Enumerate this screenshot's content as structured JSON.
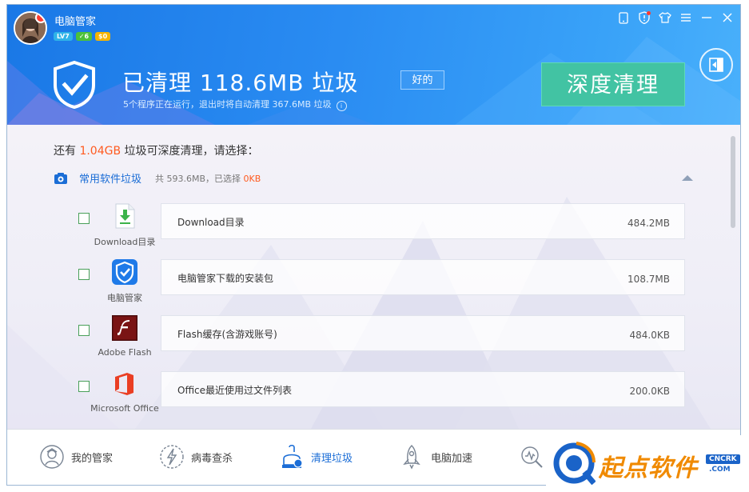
{
  "app": {
    "title": "电脑管家"
  },
  "badges": {
    "level": "LV7",
    "green": "✓6",
    "gold": "$0"
  },
  "header": {
    "headline": "已清理 118.6MB 垃圾",
    "rating": "好的",
    "subline": "5个程序正在运行，退出时将自动清理 367.6MB 垃圾",
    "deep_clean_label": "深度清理"
  },
  "summary": {
    "prefix": "还有 ",
    "amount": "1.04GB",
    "suffix": " 垃圾可深度清理，请选择："
  },
  "category": {
    "name": "常用软件垃圾",
    "stats_prefix": "共 593.6MB，已选择 ",
    "selected": "0KB"
  },
  "items": [
    {
      "app_name": "Download目录",
      "label": "Download目录",
      "size": "484.2MB",
      "icon": "download-folder-icon",
      "checked": false
    },
    {
      "app_name": "电脑管家",
      "label": "电脑管家下载的安装包",
      "size": "108.7MB",
      "icon": "pc-manager-icon",
      "checked": false
    },
    {
      "app_name": "Adobe Flash",
      "label": "Flash缓存(含游戏账号)",
      "size": "484.0KB",
      "icon": "adobe-flash-icon",
      "checked": false
    },
    {
      "app_name": "Microsoft Office",
      "label": "Office最近使用过文件列表",
      "size": "200.0KB",
      "icon": "microsoft-office-icon",
      "checked": false
    }
  ],
  "nav": [
    {
      "label": "我的管家",
      "icon": "butler-icon",
      "active": false
    },
    {
      "label": "病毒查杀",
      "icon": "lightning-shield-icon",
      "active": false
    },
    {
      "label": "清理垃圾",
      "icon": "broom-icon",
      "active": true
    },
    {
      "label": "电脑加速",
      "icon": "rocket-icon",
      "active": false
    },
    {
      "label": "",
      "icon": "magnifier-icon",
      "active": false
    }
  ],
  "watermark": {
    "text": "起点软件",
    "tag": "CNCRK",
    "domain": ".COM"
  },
  "colors": {
    "accent": "#1b6dd6",
    "highlight": "#ff5a1f",
    "deep_clean": "#42c3a3",
    "header": "#2a8cf2"
  }
}
